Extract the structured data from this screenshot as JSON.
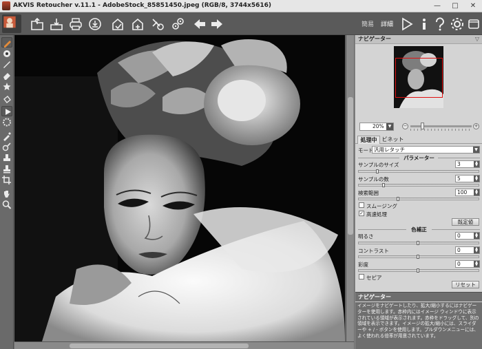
{
  "window": {
    "title": "AKVIS Retoucher v.11.1 - AdobeStock_85851450.jpeg (RGB/8, 3744x5616)",
    "controls": [
      "—",
      "□",
      "✕"
    ]
  },
  "toolbar": {
    "buttons": [
      "open-icon",
      "save-icon",
      "print-icon",
      "share-icon",
      "import-icon",
      "export-icon",
      "settings-gear-icon",
      "multi-gear-icon",
      "undo-icon",
      "redo-icon"
    ],
    "mode_simple": "簡易",
    "mode_detail": "詳細",
    "right_icons": [
      "run-icon",
      "info-icon",
      "help-icon",
      "preferences-icon",
      "notification-icon"
    ]
  },
  "lefttools": [
    "retouch-brush-icon",
    "color-picker-icon",
    "pen-icon",
    "eraser-icon",
    "magic-icon",
    "paint-bucket-icon",
    "play-icon",
    "gear-icon",
    "eyedropper-icon",
    "patch-icon",
    "stamp-icon",
    "healing-icon",
    "crop-icon",
    "hand-icon",
    "zoom-icon"
  ],
  "panel": {
    "navigator_title": "ナビゲーター",
    "zoom_value": "20%",
    "zoom_minus": "−",
    "zoom_plus": "+",
    "tab_processing": "処理中",
    "tab_vignette": "ビネット",
    "mode_label": "モード",
    "mode_value": "汎用レタッチ",
    "params_title": "パラメーター",
    "sample_size_label": "サンプルのサイズ",
    "sample_size_value": "3",
    "sample_count_label": "サンプルの数",
    "sample_count_value": "5",
    "search_range_label": "検索範囲",
    "search_range_value": "100",
    "smoothing_label": "スムージング",
    "fast_label": "高速処理",
    "default_button": "既定値",
    "color_correction_title": "色補正",
    "brightness_label": "明るさ",
    "brightness_value": "0",
    "contrast_label": "コントラスト",
    "contrast_value": "0",
    "saturation_label": "彩度",
    "saturation_value": "0",
    "sepia_label": "セピア",
    "reset_button": "リセット",
    "hint_title": "ナビゲーター",
    "hint_text": "イメージをナビゲートしたり、拡大/縮小するにはナビゲーターを使用します。赤枠内にはイメージ ウィンドウに表示されている領域が表示されます。赤枠をドラッグして、別の領域を表示できます。イメージの拡大/縮小には、スライダーや + / - ボタンを使用します。プルダウンメニューには、よく使われる倍率が用意されています。"
  },
  "state": {
    "smoothing_checked": false,
    "fast_checked": true,
    "sepia_checked": false,
    "sample_size_fraction": 0.15,
    "sample_count_fraction": 0.2,
    "search_range_fraction": 0.33,
    "brightness_fraction": 0.5,
    "contrast_fraction": 0.5,
    "saturation_fraction": 0.5,
    "zoom_fraction": 0.18
  },
  "colors": {
    "toolbar_bg": "#5a5a5a",
    "panel_bg": "#d4d4d4",
    "nav_frame": "#e01010"
  }
}
